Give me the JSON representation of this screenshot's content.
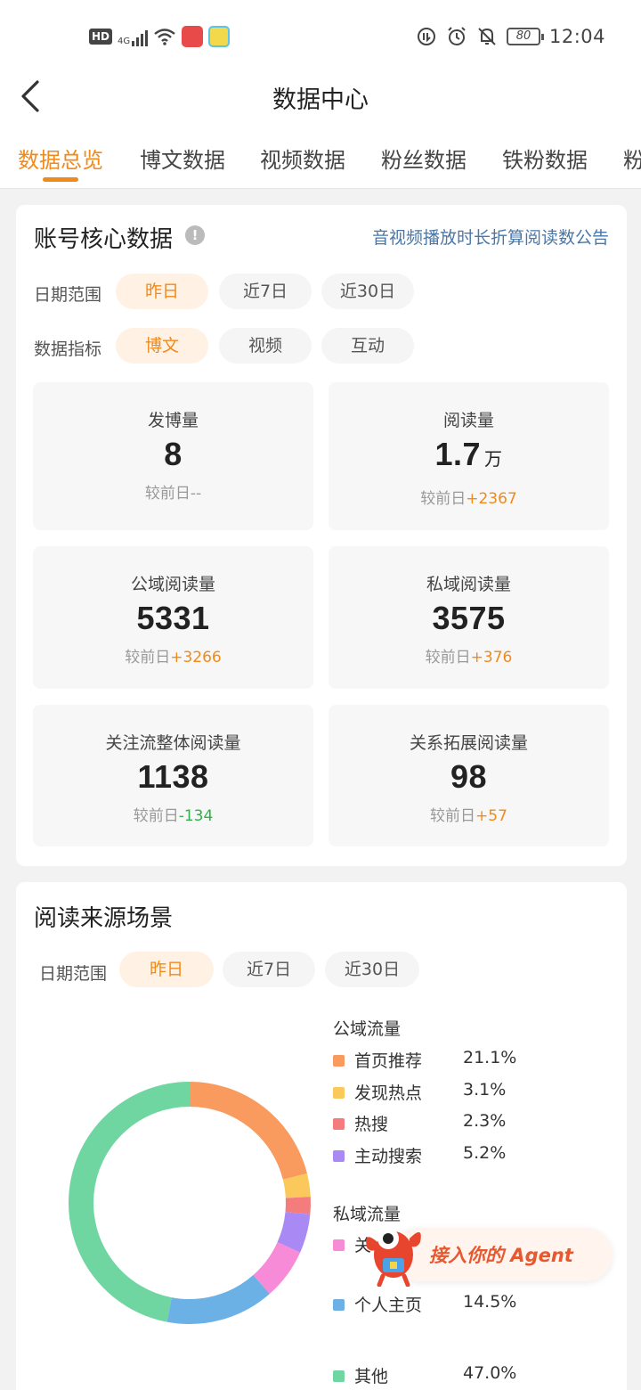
{
  "status_bar": {
    "hd": "HD",
    "network": "4G",
    "battery": "80",
    "time": "12:04"
  },
  "header": {
    "title": "数据中心"
  },
  "tabs": [
    {
      "label": "数据总览",
      "active": true
    },
    {
      "label": "博文数据",
      "active": false
    },
    {
      "label": "视频数据",
      "active": false
    },
    {
      "label": "粉丝数据",
      "active": false
    },
    {
      "label": "铁粉数据",
      "active": false
    },
    {
      "label": "粉",
      "active": false
    }
  ],
  "core": {
    "title": "账号核心数据",
    "info": "!",
    "notice": "音视频播放时长折算阅读数公告",
    "date_label": "日期范围",
    "date_options": [
      "昨日",
      "近7日",
      "近30日"
    ],
    "metric_label": "数据指标",
    "metric_options": [
      "博文",
      "视频",
      "互动"
    ],
    "stats": [
      {
        "label": "发博量",
        "value": "8",
        "unit": "",
        "delta_prefix": "较前日",
        "delta": "--"
      },
      {
        "label": "阅读量",
        "value": "1.7",
        "unit": "万",
        "delta_prefix": "较前日",
        "delta": "+2367"
      },
      {
        "label": "公域阅读量",
        "value": "5331",
        "unit": "",
        "delta_prefix": "较前日",
        "delta": "+3266"
      },
      {
        "label": "私域阅读量",
        "value": "3575",
        "unit": "",
        "delta_prefix": "较前日",
        "delta": "+376"
      },
      {
        "label": "关注流整体阅读量",
        "value": "1138",
        "unit": "",
        "delta_prefix": "较前日",
        "delta": "-134"
      },
      {
        "label": "关系拓展阅读量",
        "value": "98",
        "unit": "",
        "delta_prefix": "较前日",
        "delta": "+57"
      }
    ]
  },
  "source": {
    "title": "阅读来源场景",
    "date_label": "日期范围",
    "date_options": [
      "昨日",
      "近7日",
      "近30日"
    ],
    "public_label": "公域流量",
    "private_label": "私域流量",
    "legend": [
      {
        "name": "首页推荐",
        "value": "21.1%",
        "color": "#f99a5e"
      },
      {
        "name": "发现热点",
        "value": "3.1%",
        "color": "#fbc95b"
      },
      {
        "name": "热搜",
        "value": "2.3%",
        "color": "#f47c7c"
      },
      {
        "name": "主动搜索",
        "value": "5.2%",
        "color": "#a98af5"
      },
      {
        "name": "关",
        "value": "",
        "color": "#f88bd8"
      },
      {
        "name": "个人主页",
        "value": "14.5%",
        "color": "#6bb1e6"
      },
      {
        "name": "其他",
        "value": "47.0%",
        "color": "#6fd6a1"
      }
    ],
    "donut_percentages": [
      21.1,
      3.1,
      2.3,
      5.2,
      6.8,
      14.5,
      47.0
    ]
  },
  "agent_banner": {
    "text": "接入你的 Agent"
  }
}
